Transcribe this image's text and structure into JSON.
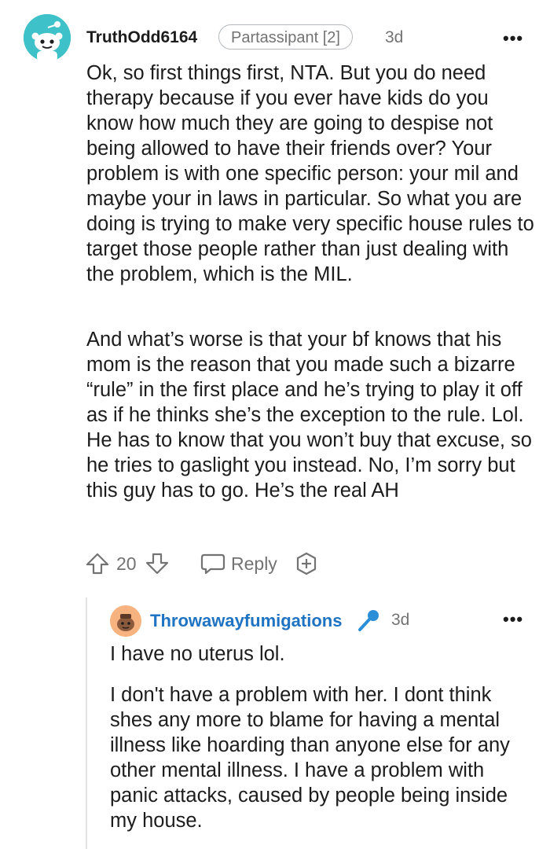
{
  "comment": {
    "username": "TruthOdd6164",
    "flair": "Partassipant [2]",
    "time": "3d",
    "more": "•••",
    "paragraphs": [
      "Ok, so first things first, NTA. But you do need therapy because if you ever have kids do you know how much they are going to despise not being allowed to have their friends over? Your problem is with one specific person: your mil and maybe your in laws in particular. So what you are doing is trying to make very specific house rules to target those people rather than just dealing with the problem, which is the MIL.",
      "And what’s worse is that your bf knows that his mom is the reason that you made such a bizarre “rule” in the first place and he’s trying to play it off as if he thinks she’s the exception to the rule. Lol. He has to know that you won’t buy that excuse, so he tries to gaslight you instead. No, I’m sorry but this guy has to go. He’s the real AH"
    ],
    "votes": "20",
    "reply_label": "Reply",
    "icons": {
      "upvote": "upvote-arrow-icon",
      "downvote": "downvote-arrow-icon",
      "reply": "speech-bubble-icon",
      "award": "award-plus-icon"
    },
    "avatar_color": "#3fc1c9"
  },
  "reply": {
    "username": "Throwawayfumigations",
    "time": "3d",
    "more": "•••",
    "badge_icon": "microphone-icon",
    "paragraphs": [
      "I have no uterus lol.",
      "I don't have a problem with her. I dont think shes any more to blame for having a mental illness like hoarding than anyone else for any other mental illness. I have a problem with panic attacks, caused by people being inside my house."
    ],
    "avatar_color": "#f6b37f",
    "username_color": "#1f73c3"
  }
}
